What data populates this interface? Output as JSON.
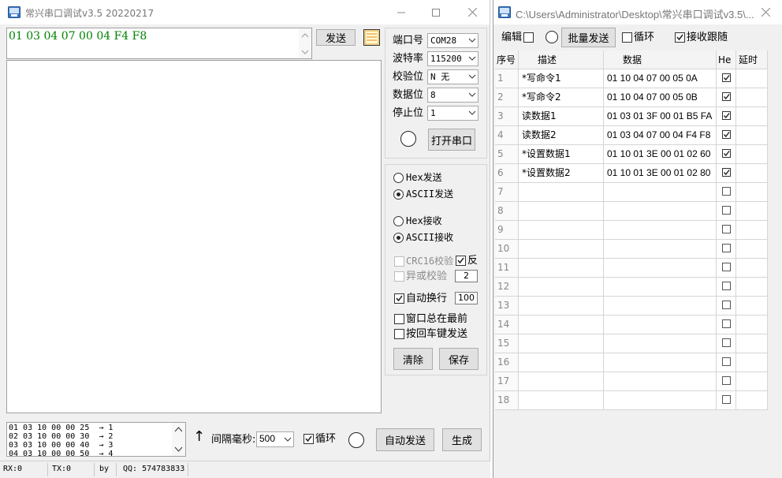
{
  "left": {
    "title": "常兴串口调试v3.5 20220217",
    "send_text": "01 03 04 07 00 04 F4 F8",
    "send_button": "发送",
    "port": {
      "port_label": "端口号",
      "port_value": "COM28",
      "baud_label": "波特率",
      "baud_value": "115200",
      "parity_label": "校验位",
      "parity_value": "N 无",
      "databits_label": "数据位",
      "databits_value": "8",
      "stopbits_label": "停止位",
      "stopbits_value": "1",
      "open_button": "打开串口"
    },
    "options": {
      "hex_send": "Hex发送",
      "ascii_send": "ASCII发送",
      "hex_recv": "Hex接收",
      "ascii_recv": "ASCII接收",
      "crc16": "CRC16校验",
      "reverse": "反",
      "xor": "异或校验",
      "xor_value": "2",
      "auto_newline": "自动换行",
      "auto_newline_value": "100",
      "always_top": "窗口总在最前",
      "enter_send": "按回车键发送",
      "clear_button": "清除",
      "save_button": "保存"
    },
    "bottom": {
      "cmd_rows": [
        "01 03 10 00 00 25  → 1",
        "02 03 10 00 00 30  → 2",
        "03 03 10 00 00 40  → 3",
        "04 03 10 00 00 50  → 4"
      ],
      "up_arrow": "↑",
      "interval_label": "间隔毫秒:",
      "interval_value": "500",
      "loop_label": "循环",
      "auto_send_button": "自动发送",
      "generate_button": "生成"
    },
    "status": {
      "rx": "RX:0",
      "tx": "TX:0",
      "by": "by",
      "qq": "QQ: 574783833"
    }
  },
  "right": {
    "title": "C:\\Users\\Administrator\\Desktop\\常兴串口调试v3.5\\...",
    "toolbar": {
      "edit_label": "编辑",
      "batch_send_button": "批量发送",
      "loop_label": "循环",
      "recv_follow_label": "接收跟随"
    },
    "columns": [
      "序号",
      "描述",
      "数据",
      "He",
      "延时"
    ],
    "rows": [
      {
        "no": "1",
        "desc": "*写命令1",
        "data": "01 10 04 07 00 05 0A",
        "hex": true
      },
      {
        "no": "2",
        "desc": "*写命令2",
        "data": "01 10 04 07 00 05 0B",
        "hex": true
      },
      {
        "no": "3",
        "desc": "读数据1",
        "data": "01 03 01 3F 00 01 B5 FA",
        "hex": true
      },
      {
        "no": "4",
        "desc": "读数据2",
        "data": "01 03 04 07 00 04 F4 F8",
        "hex": true
      },
      {
        "no": "5",
        "desc": "*设置数据1",
        "data": "01 10 01 3E 00 01 02 60",
        "hex": true
      },
      {
        "no": "6",
        "desc": "*设置数据2",
        "data": "01 10 01 3E 00 01 02 80",
        "hex": true
      },
      {
        "no": "7",
        "desc": "",
        "data": "",
        "hex": false
      },
      {
        "no": "8",
        "desc": "",
        "data": "",
        "hex": false
      },
      {
        "no": "9",
        "desc": "",
        "data": "",
        "hex": false
      },
      {
        "no": "10",
        "desc": "",
        "data": "",
        "hex": false
      },
      {
        "no": "11",
        "desc": "",
        "data": "",
        "hex": false
      },
      {
        "no": "12",
        "desc": "",
        "data": "",
        "hex": false
      },
      {
        "no": "13",
        "desc": "",
        "data": "",
        "hex": false
      },
      {
        "no": "14",
        "desc": "",
        "data": "",
        "hex": false
      },
      {
        "no": "15",
        "desc": "",
        "data": "",
        "hex": false
      },
      {
        "no": "16",
        "desc": "",
        "data": "",
        "hex": false
      },
      {
        "no": "17",
        "desc": "",
        "data": "",
        "hex": false
      },
      {
        "no": "18",
        "desc": "",
        "data": "",
        "hex": false
      }
    ]
  }
}
